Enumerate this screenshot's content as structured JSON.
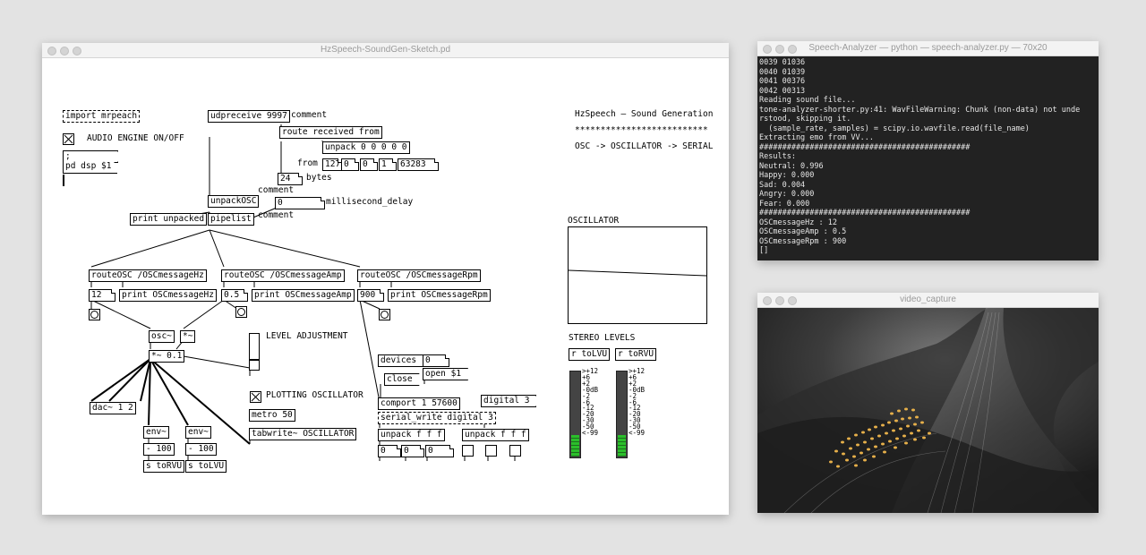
{
  "pd": {
    "title": "HzSpeech-SoundGen-Sketch.pd",
    "import": "import mrpeach",
    "audio_engine": "AUDIO ENGINE ON/OFF",
    "dsp_msg_line1": ";",
    "dsp_msg_line2": "pd dsp $1",
    "udpreceive": "udpreceive 9997",
    "comment1": "comment",
    "route_received": "route received from",
    "unpack": "unpack 0 0 0 0 0",
    "from": "from",
    "ip1": "127",
    "ip2": "0",
    "ip3": "0",
    "ip4": "1",
    "port": "63283",
    "bytes_num": "24",
    "bytes": "bytes",
    "comment2": "comment",
    "unpackosc": "unpackOSC",
    "delay_num": "0",
    "millisecond_delay": "millisecond_delay",
    "print_unpacked": "print unpacked",
    "pipelist": "pipelist",
    "comment3": "comment",
    "route_hz": "routeOSC /OSCmessageHz",
    "route_amp": "routeOSC /OSCmessageAmp",
    "route_rpm": "routeOSC /OSCmessageRpm",
    "hz_val": "12",
    "amp_val": "0.5",
    "rpm_val": "900",
    "print_hz": "print OSCmessageHz",
    "print_amp": "print OSCmessageAmp",
    "print_rpm": "print OSCmessageRpm",
    "osc": "osc~",
    "mul": "*~",
    "mul01": "*~ 0.1",
    "level_adj": "LEVEL ADJUSTMENT",
    "dac": "dac~ 1 2",
    "env1": "env~",
    "env2": "env~",
    "minus1": "- 100",
    "minus2": "- 100",
    "s_torvu": "s toRVU",
    "s_tolvu": "s toLVU",
    "plotting": "PLOTTING OSCILLATOR",
    "metro": "metro 50",
    "tabwrite": "tabwrite~ OSCILLATOR",
    "devices": "devices",
    "zero_msg": "0",
    "open": "open $1",
    "close": "close",
    "comport": "comport 1 57600",
    "digital": "digital 3",
    "serial_write": "serial_write digital 3",
    "unpack_fff1": "unpack f f f",
    "unpack_fff2": "unpack f f f",
    "out1": "0",
    "out2": "0",
    "out3": "0",
    "header_title": "HzSpeech — Sound Generation",
    "header_stars": "**************************",
    "header_flow": "OSC -> OSCILLATOR -> SERIAL",
    "oscillator_label": "OSCILLATOR",
    "stereo_levels": "STEREO LEVELS",
    "r_tolvu": "r toLVU",
    "r_torvu": "r toRVU",
    "vu_scale": ">+12\n+6\n+2\n-0dB\n-2\n-6\n-12\n-20\n-30\n-50\n<-99",
    "vu_left_level": 0.25,
    "vu_right_level": 0.25
  },
  "terminal": {
    "title": "Speech-Analyzer — python — speech-analyzer.py — 70x20",
    "lines": [
      "0039 01036",
      "0040 01039",
      "0041 00376",
      "0042 00313",
      "Reading sound file...",
      "tone-analyzer-shorter.py:41: WavFileWarning: Chunk (non-data) not unde",
      "rstood, skipping it.",
      "  (sample_rate, samples) = scipy.io.wavfile.read(file_name)",
      "Extracting emo from VV...",
      "##############################################",
      "Results:",
      "Neutral: 0.996",
      "Happy: 0.000",
      "Sad: 0.004",
      "Angry: 0.000",
      "Fear: 0.000",
      "##############################################",
      "OSCmessageHz : 12",
      "OSCmessageAmp : 0.5",
      "OSCmessageRpm : 900",
      "[]"
    ]
  },
  "video": {
    "title": "video_capture"
  },
  "colors": {
    "terminal_bg": "#222222",
    "vu_green": "#2bbf2b"
  }
}
